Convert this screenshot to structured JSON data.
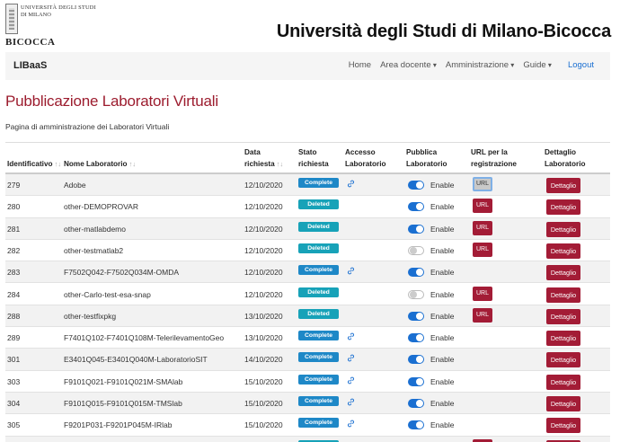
{
  "header": {
    "logo": {
      "line1": "UNIVERSITÀ DEGLI STUDI",
      "line2": "DI MILANO",
      "line3": "",
      "big": "BICOCCA"
    },
    "site_title": "Università degli Studi di Milano-Bicocca"
  },
  "navbar": {
    "brand": "LIBaaS",
    "items": [
      {
        "label": "Home",
        "dropdown": false
      },
      {
        "label": "Area docente",
        "dropdown": true
      },
      {
        "label": "Amministrazione",
        "dropdown": true
      },
      {
        "label": "Guide",
        "dropdown": true
      }
    ],
    "logout": "Logout"
  },
  "page": {
    "title": "Pubblicazione Laboratori Virtuali",
    "subtitle": "Pagina di amministrazione dei Laboratori Virtuali"
  },
  "table": {
    "columns": [
      {
        "l1": "",
        "l2": "Identificativo",
        "sortable": true
      },
      {
        "l1": "",
        "l2": "Nome Laboratorio",
        "sortable": true
      },
      {
        "l1": "Data",
        "l2": "richiesta",
        "sortable": true
      },
      {
        "l1": "Stato",
        "l2": "richiesta",
        "sortable": false
      },
      {
        "l1": "Accesso",
        "l2": "Laboratorio",
        "sortable": false
      },
      {
        "l1": "Pubblica",
        "l2": "Laboratorio",
        "sortable": false
      },
      {
        "l1": "URL per la",
        "l2": "registrazione",
        "sortable": false
      },
      {
        "l1": "Dettaglio",
        "l2": "Laboratorio",
        "sortable": false
      }
    ],
    "enable_label": "Enable",
    "url_label": "URL",
    "detail_label": "Dettaglio",
    "rows": [
      {
        "id": "279",
        "name": "Adobe",
        "date": "12/10/2020",
        "status": "Complete",
        "access": true,
        "published": true,
        "url": "active"
      },
      {
        "id": "280",
        "name": "other-DEMOPROVAR",
        "date": "12/10/2020",
        "status": "Deleted",
        "access": false,
        "published": true,
        "url": "yes"
      },
      {
        "id": "281",
        "name": "other-matlabdemo",
        "date": "12/10/2020",
        "status": "Deleted",
        "access": false,
        "published": true,
        "url": "yes"
      },
      {
        "id": "282",
        "name": "other-testmatlab2",
        "date": "12/10/2020",
        "status": "Deleted",
        "access": false,
        "published": false,
        "url": "yes"
      },
      {
        "id": "283",
        "name": "F7502Q042-F7502Q034M-OMDA",
        "date": "12/10/2020",
        "status": "Complete",
        "access": true,
        "published": true,
        "url": "no"
      },
      {
        "id": "284",
        "name": "other-Carlo-test-esa-snap",
        "date": "12/10/2020",
        "status": "Deleted",
        "access": false,
        "published": false,
        "url": "yes"
      },
      {
        "id": "288",
        "name": "other-testfixpkg",
        "date": "13/10/2020",
        "status": "Deleted",
        "access": false,
        "published": true,
        "url": "yes"
      },
      {
        "id": "289",
        "name": "F7401Q102-F7401Q108M-TelerilevamentoGeo",
        "date": "13/10/2020",
        "status": "Complete",
        "access": true,
        "published": true,
        "url": "no"
      },
      {
        "id": "301",
        "name": "E3401Q045-E3401Q040M-LaboratorioSIT",
        "date": "14/10/2020",
        "status": "Complete",
        "access": true,
        "published": true,
        "url": "no"
      },
      {
        "id": "303",
        "name": "F9101Q021-F9101Q021M-SMAlab",
        "date": "15/10/2020",
        "status": "Complete",
        "access": true,
        "published": true,
        "url": "no"
      },
      {
        "id": "304",
        "name": "F9101Q015-F9101Q015M-TMSlab",
        "date": "15/10/2020",
        "status": "Complete",
        "access": true,
        "published": true,
        "url": "no"
      },
      {
        "id": "305",
        "name": "F9201P031-F9201P045M-IRlab",
        "date": "15/10/2020",
        "status": "Complete",
        "access": true,
        "published": true,
        "url": "no"
      },
      {
        "id": "",
        "name": "",
        "date": "",
        "status": "Deleted",
        "access": false,
        "published": true,
        "url": "yes"
      }
    ]
  },
  "colors": {
    "brand_red": "#a31c36",
    "title_red": "#9c1c2e",
    "toggle_blue": "#1a6fd1",
    "badge_complete": "#1e88c7",
    "badge_deleted": "#17a2b8"
  }
}
